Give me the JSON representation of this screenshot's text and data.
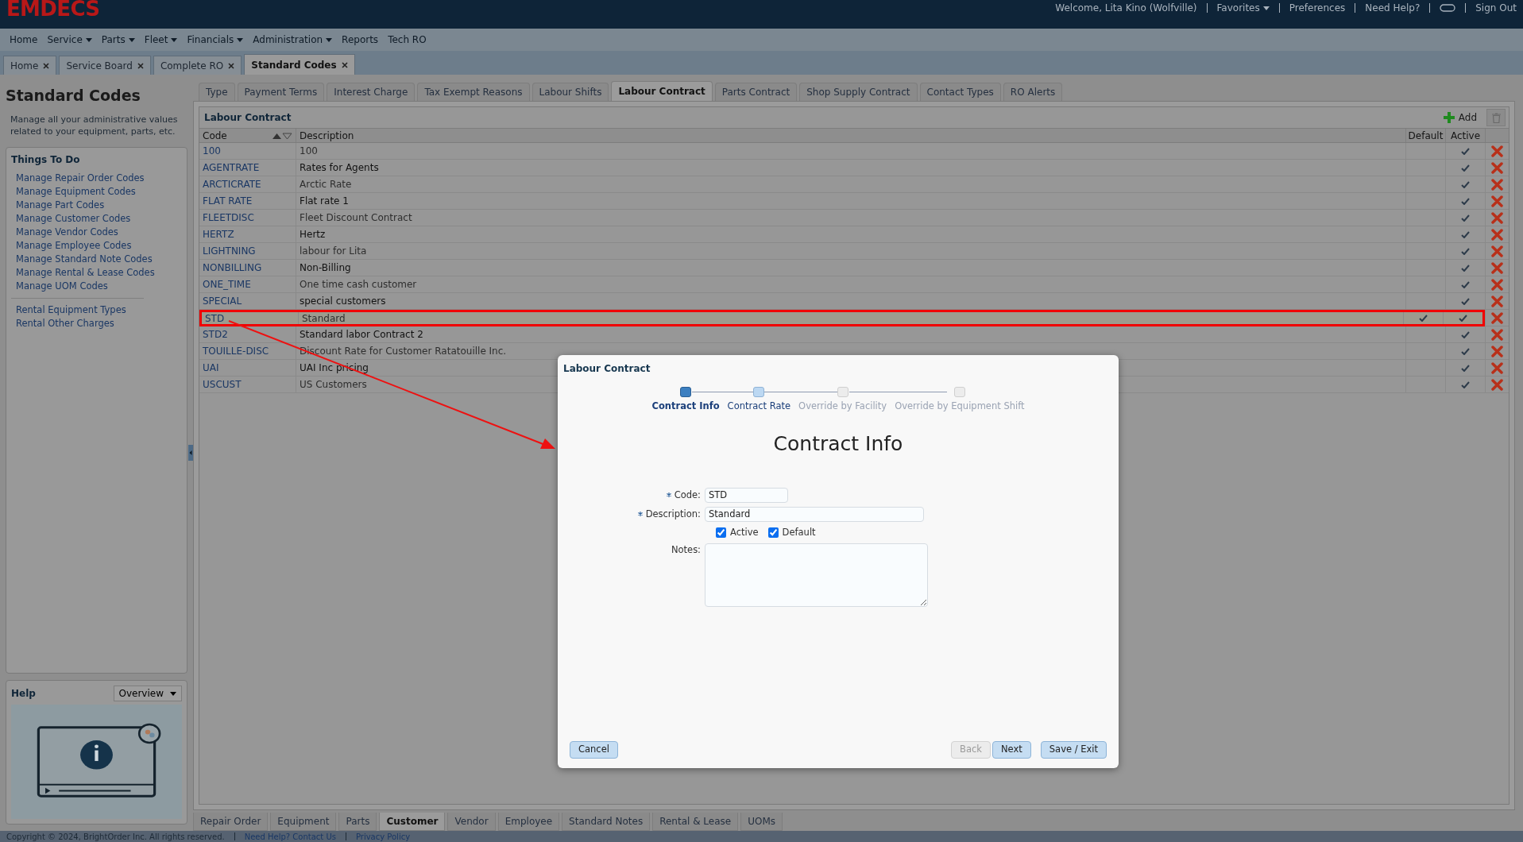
{
  "header": {
    "logo": "EMDECS",
    "welcome": "Welcome, Lita Kino (Wolfville)",
    "links": [
      {
        "label": "Favorites",
        "dropdown": true
      },
      {
        "label": "Preferences",
        "dropdown": false
      },
      {
        "label": "Need Help?",
        "dropdown": false
      }
    ],
    "sign_out": "Sign Out"
  },
  "menu": [
    {
      "label": "Home",
      "dropdown": false
    },
    {
      "label": "Service",
      "dropdown": true
    },
    {
      "label": "Parts",
      "dropdown": true
    },
    {
      "label": "Fleet",
      "dropdown": true
    },
    {
      "label": "Financials",
      "dropdown": true
    },
    {
      "label": "Administration",
      "dropdown": true
    },
    {
      "label": "Reports",
      "dropdown": false
    },
    {
      "label": "Tech RO",
      "dropdown": false
    }
  ],
  "page_tabs": [
    {
      "label": "Home",
      "selected": false
    },
    {
      "label": "Service Board",
      "selected": false
    },
    {
      "label": "Complete RO",
      "selected": false
    },
    {
      "label": "Standard Codes",
      "selected": true
    }
  ],
  "sidebar": {
    "title": "Standard Codes",
    "description": "Manage all your administrative values related to your equipment, parts, etc.",
    "things_to_do": {
      "title": "Things To Do",
      "groups": [
        [
          "Manage Repair Order Codes",
          "Manage Equipment Codes",
          "Manage Part Codes",
          "Manage Customer Codes",
          "Manage Vendor Codes",
          "Manage Employee Codes",
          "Manage Standard Note Codes",
          "Manage Rental & Lease Codes",
          "Manage UOM Codes"
        ],
        [
          "Rental Equipment Types",
          "Rental Other Charges"
        ]
      ]
    },
    "help": {
      "title": "Help",
      "select": "Overview"
    }
  },
  "code_tabs": [
    {
      "label": "Type",
      "selected": false
    },
    {
      "label": "Payment Terms",
      "selected": false
    },
    {
      "label": "Interest Charge",
      "selected": false
    },
    {
      "label": "Tax Exempt Reasons",
      "selected": false
    },
    {
      "label": "Labour Shifts",
      "selected": false
    },
    {
      "label": "Labour Contract",
      "selected": true
    },
    {
      "label": "Parts Contract",
      "selected": false
    },
    {
      "label": "Shop Supply Contract",
      "selected": false
    },
    {
      "label": "Contact Types",
      "selected": false
    },
    {
      "label": "RO Alerts",
      "selected": false
    }
  ],
  "table": {
    "title": "Labour Contract",
    "add": "Add",
    "columns": [
      "Code",
      "Description",
      "Default",
      "Active"
    ],
    "rows": [
      {
        "code": "100",
        "description": "100",
        "default": false,
        "active": true,
        "highlighted": false
      },
      {
        "code": "AGENTRATE",
        "description": "Rates for Agents",
        "default": false,
        "active": true,
        "highlighted": false
      },
      {
        "code": "ARCTICRATE",
        "description": "Arctic Rate",
        "default": false,
        "active": true,
        "highlighted": false
      },
      {
        "code": "FLAT RATE",
        "description": "Flat rate 1",
        "default": false,
        "active": true,
        "highlighted": false
      },
      {
        "code": "FLEETDISC",
        "description": "Fleet Discount Contract",
        "default": false,
        "active": true,
        "highlighted": false
      },
      {
        "code": "HERTZ",
        "description": "Hertz",
        "default": false,
        "active": true,
        "highlighted": false
      },
      {
        "code": "LIGHTNING",
        "description": "labour for Lita",
        "default": false,
        "active": true,
        "highlighted": false
      },
      {
        "code": "NONBILLING",
        "description": "Non-Billing",
        "default": false,
        "active": true,
        "highlighted": false
      },
      {
        "code": "ONE_TIME",
        "description": "One time cash customer",
        "default": false,
        "active": true,
        "highlighted": false
      },
      {
        "code": "SPECIAL",
        "description": "special customers",
        "default": false,
        "active": true,
        "highlighted": false
      },
      {
        "code": "STD",
        "description": "Standard",
        "default": true,
        "active": true,
        "highlighted": true
      },
      {
        "code": "STD2",
        "description": "Standard labor Contract 2",
        "default": false,
        "active": true,
        "highlighted": false
      },
      {
        "code": "TOUILLE-DISC",
        "description": "Discount Rate for Customer Ratatouille Inc.",
        "default": false,
        "active": true,
        "highlighted": false
      },
      {
        "code": "UAI",
        "description": "UAI Inc pricing",
        "default": false,
        "active": true,
        "highlighted": false
      },
      {
        "code": "USCUST",
        "description": "US Customers",
        "default": false,
        "active": true,
        "highlighted": false
      }
    ]
  },
  "modal": {
    "title": "Labour Contract",
    "steps": [
      {
        "label": "Contract Info",
        "selected": true,
        "disabled": false
      },
      {
        "label": "Contract Rate",
        "selected": false,
        "disabled": false
      },
      {
        "label": "Override by Facility",
        "selected": false,
        "disabled": true
      },
      {
        "label": "Override by Equipment Shift",
        "selected": false,
        "disabled": true
      }
    ],
    "heading": "Contract Info",
    "fields": [
      {
        "label": "Code:",
        "value": "STD",
        "required": true
      },
      {
        "label": "Description:",
        "value": "Standard",
        "required": true
      }
    ],
    "checkboxes": [
      {
        "label": "Active",
        "checked": true
      },
      {
        "label": "Default",
        "checked": true
      }
    ],
    "notes_label": "Notes:",
    "buttons": [
      {
        "label": "Cancel",
        "disabled": false
      },
      {
        "label": "Back",
        "disabled": true
      },
      {
        "label": "Next",
        "disabled": false
      },
      {
        "label": "Save / Exit",
        "disabled": false
      }
    ]
  },
  "bottom_tabs": [
    {
      "label": "Repair Order",
      "selected": false
    },
    {
      "label": "Equipment",
      "selected": false
    },
    {
      "label": "Parts",
      "selected": false
    },
    {
      "label": "Customer",
      "selected": true
    },
    {
      "label": "Vendor",
      "selected": false
    },
    {
      "label": "Employee",
      "selected": false
    },
    {
      "label": "Standard Notes",
      "selected": false
    },
    {
      "label": "Rental & Lease",
      "selected": false
    },
    {
      "label": "UOMs",
      "selected": false
    }
  ],
  "footer": {
    "copyright": "Copyright © 2024, BrightOrder Inc. All rights reserved.",
    "links": [
      "Need Help? Contact Us",
      "Privacy Policy"
    ]
  }
}
